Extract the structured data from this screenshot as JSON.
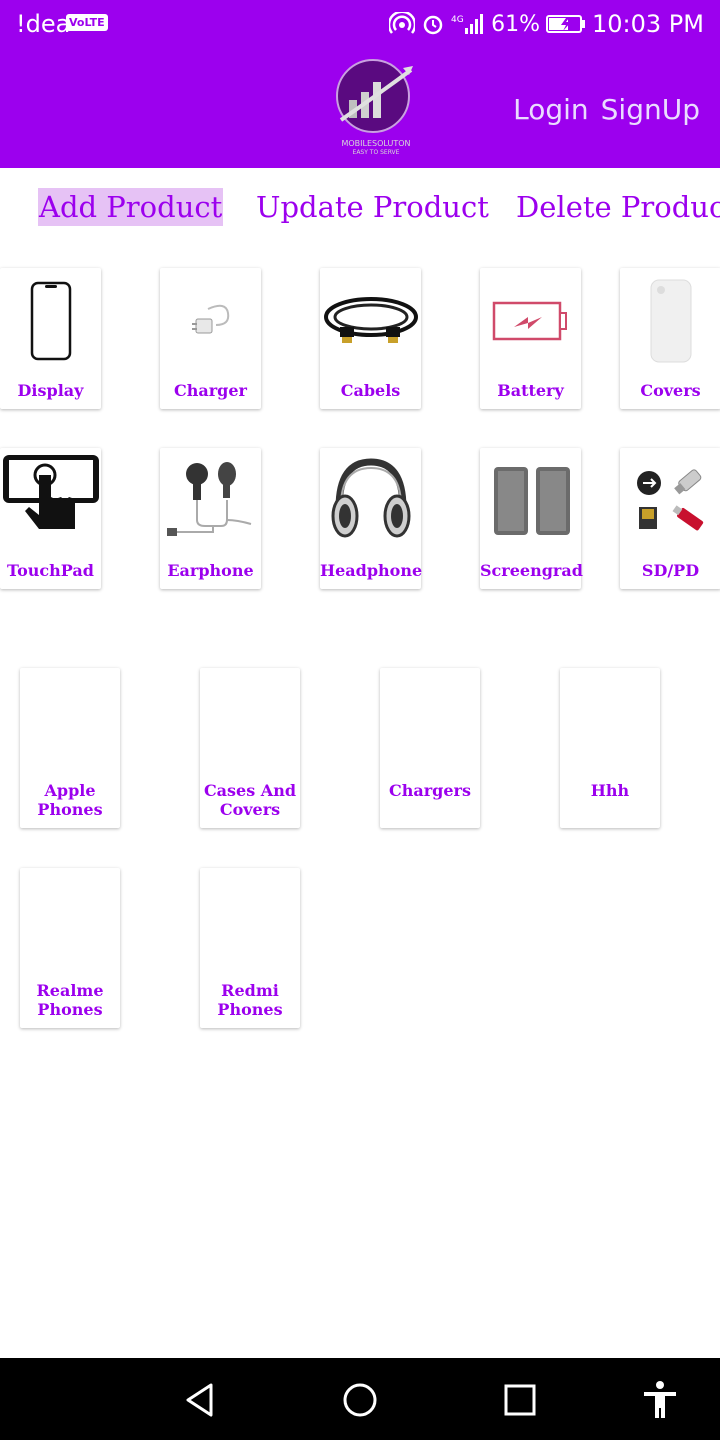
{
  "status_bar": {
    "carrier": "!dea",
    "volte": "VoLTE",
    "battery": "61%",
    "time": "10:03 PM"
  },
  "header": {
    "logo_icon": "mobile-solution-logo-icon",
    "login": "Login",
    "signup": "SignUp"
  },
  "tabs": {
    "add": "Add Product",
    "update": "Update Product",
    "delete": "Delete Product"
  },
  "products": [
    {
      "label": "Display",
      "icon": "phone-display-icon"
    },
    {
      "label": "Charger",
      "icon": "charger-icon"
    },
    {
      "label": "Cabels",
      "icon": "hdmi-cable-icon"
    },
    {
      "label": "Battery",
      "icon": "battery-icon"
    },
    {
      "label": "Covers",
      "icon": "phone-cover-icon"
    },
    {
      "label": "TouchPad",
      "icon": "touch-hand-icon"
    },
    {
      "label": "Earphone",
      "icon": "earphone-icon"
    },
    {
      "label": "Headphone",
      "icon": "headphone-icon"
    },
    {
      "label": "Screengrad",
      "icon": "screen-guard-icon"
    },
    {
      "label": "SD/PD",
      "icon": "usb-sd-icon"
    }
  ],
  "categories": [
    {
      "label": "Apple Phones"
    },
    {
      "label": "Cases And Covers"
    },
    {
      "label": "Chargers"
    },
    {
      "label": "Hhh"
    },
    {
      "label": "Realme Phones"
    },
    {
      "label": "Redmi Phones"
    }
  ],
  "colors": {
    "primary": "#9c00ee",
    "tab_highlight": "#e6c2f5",
    "nav_bar": "#000000"
  }
}
